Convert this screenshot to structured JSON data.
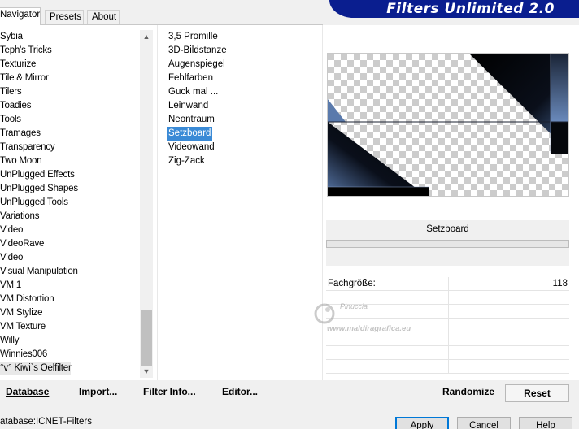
{
  "header": {
    "title": "Filters Unlimited 2.0"
  },
  "tabs": [
    {
      "label": "Navigator",
      "active": true
    },
    {
      "label": "Presets",
      "active": false
    },
    {
      "label": "About",
      "active": false
    }
  ],
  "categories": [
    "Sybia",
    "Teph's Tricks",
    "Texturize",
    "Tile & Mirror",
    "Tilers",
    "Toadies",
    "Tools",
    "Tramages",
    "Transparency",
    "Two Moon",
    "UnPlugged Effects",
    "UnPlugged Shapes",
    "UnPlugged Tools",
    "Variations",
    "Video",
    "VideoRave",
    "Video",
    "Visual Manipulation",
    "VM 1",
    "VM Distortion",
    "VM Stylize",
    "VM Texture",
    "Willy",
    "Winnies006",
    "°v° Kiwi`s Oelfilter"
  ],
  "selected_category": "°v° Kiwi`s Oelfilter",
  "filters": [
    "3,5 Promille",
    "3D-Bildstanze",
    "Augenspiegel",
    "Fehlfarben",
    "Guck mal ...",
    "Leinwand",
    "Neontraum",
    "Setzboard",
    "Videowand",
    "Zig-Zack"
  ],
  "selected_filter": "Setzboard",
  "preview": {
    "filter_name": "Setzboard",
    "accent_color": "#4a6a9c"
  },
  "params": [
    {
      "label": "Fachgröße:",
      "value": "118"
    },
    {
      "label": "",
      "value": ""
    },
    {
      "label": "",
      "value": ""
    },
    {
      "label": "",
      "value": ""
    },
    {
      "label": "",
      "value": ""
    },
    {
      "label": "",
      "value": ""
    },
    {
      "label": "",
      "value": ""
    }
  ],
  "watermark": {
    "name": "Pinuccia",
    "url": "www.maldiragrafica.eu"
  },
  "toolbar": {
    "database": "Database",
    "import": "Import...",
    "filter_info": "Filter Info...",
    "editor": "Editor...",
    "randomize": "Randomize",
    "reset": "Reset"
  },
  "status": {
    "label": "atabase:",
    "value": "ICNET-Filters",
    "sub": "..."
  },
  "dialog": {
    "apply": "Apply",
    "cancel": "Cancel",
    "help": "Help"
  },
  "colors": {
    "banner": "#0a1e8f",
    "selection": "#3a8ad6"
  }
}
